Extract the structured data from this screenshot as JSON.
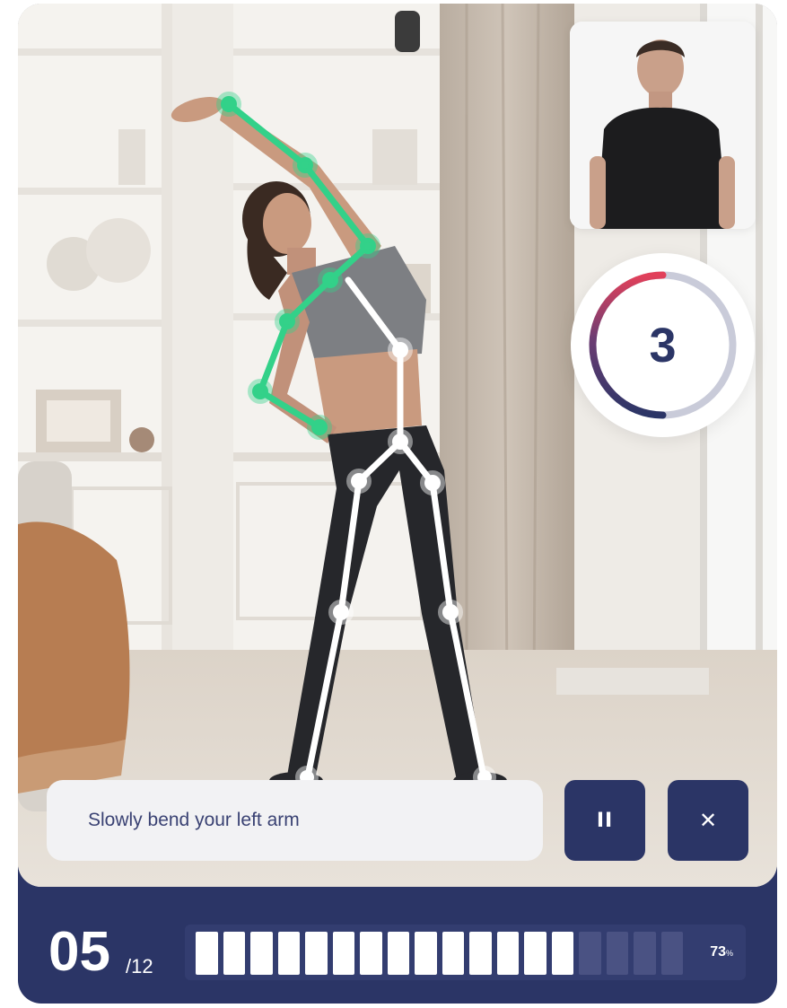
{
  "rep_counter": {
    "current": "05",
    "total": "/12"
  },
  "countdown": {
    "value": "3",
    "elapsed_fraction": 0.5
  },
  "instruction": {
    "text": "Slowly bend your left arm"
  },
  "controls": {
    "pause_label": "II",
    "close_label": "✕"
  },
  "progress": {
    "percent_value": "73",
    "percent_unit": "%",
    "total_segments": 18,
    "filled_segments": 14
  },
  "colors": {
    "brand_navy": "#2b3566",
    "skeleton_active": "#33d189",
    "skeleton_inactive": "#ffffff",
    "countdown_arc_start": "#e2405a",
    "countdown_track": "#c9cbd9"
  },
  "icons": {
    "pause": "pause-icon",
    "close": "close-icon"
  }
}
